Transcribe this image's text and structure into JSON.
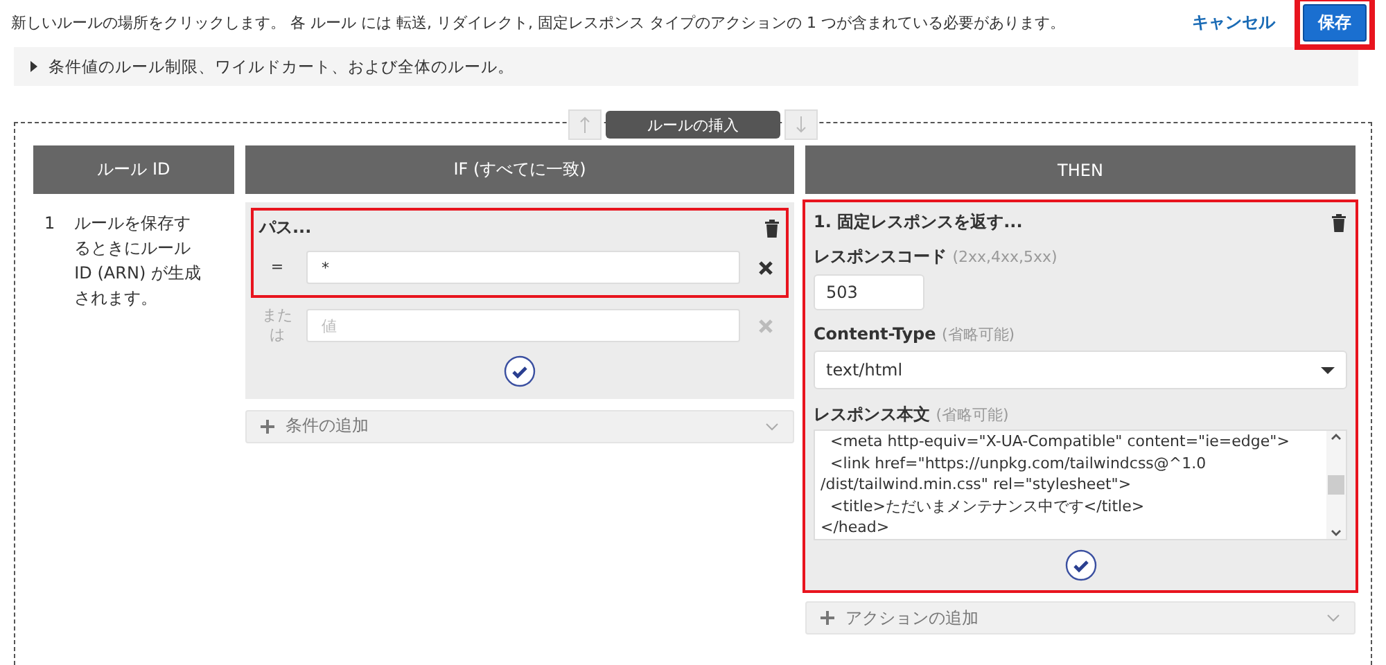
{
  "header": {
    "message": "新しいルールの場所をクリックします。 各 ルール には 転送, リダイレクト, 固定レスポンス タイプのアクションの 1 つが含まれている必要があります。",
    "cancel": "キャンセル",
    "save": {
      "label": "保存",
      "highlighted": true
    }
  },
  "hint": {
    "label": "条件値のルール制限、ワイルドカート、および全体のルール。",
    "expanded": false
  },
  "insert": {
    "label": "ルールの挿入"
  },
  "columns": [
    "ルール ID",
    "IF (すべてに一致)",
    "THEN"
  ],
  "rule": {
    "id": "1",
    "description": "ルールを保存するときにルール ID (ARN) が生成されます。"
  },
  "condition": {
    "title": "パス...",
    "highlighted": true,
    "values": [
      {
        "operator": "=",
        "value": "*",
        "disabled": false
      },
      {
        "operator": "または",
        "placeholder": "値",
        "disabled": true
      }
    ],
    "add": "条件の追加"
  },
  "action": {
    "title": "1. 固定レスポンスを返す...",
    "highlighted": true,
    "code": {
      "label": "レスポンスコード",
      "hint": "(2xx,4xx,5xx)",
      "value": "503"
    },
    "content_type": {
      "label": "Content-Type",
      "hint": "(省略可能)",
      "value": "text/html"
    },
    "body": {
      "label": "レスポンス本文",
      "hint": "(省略可能)",
      "lines": [
        "  <meta http-equiv=\"X-UA-Compatible\" content=\"ie=edge\">",
        "  <link href=\"https://unpkg.com/tailwindcss@^1.0",
        "/dist/tailwind.min.css\" rel=\"stylesheet\">",
        "  <title>ただいまメンテナンス中です</title>",
        "</head>"
      ]
    },
    "add": "アクションの追加"
  }
}
